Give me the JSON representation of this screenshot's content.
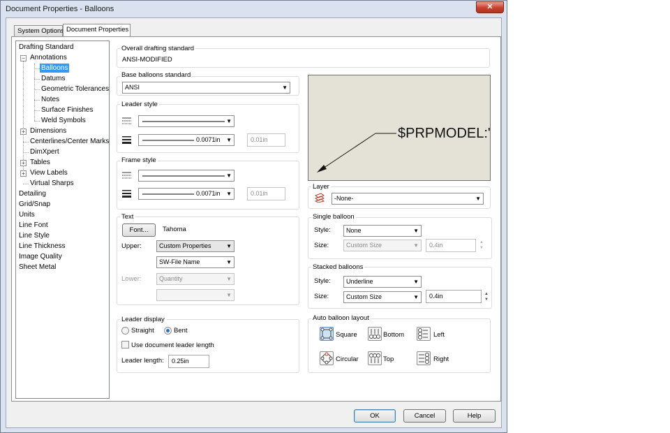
{
  "window": {
    "title": "Document Properties - Balloons",
    "close_glyph": "✕"
  },
  "tabs": [
    {
      "label": "System Options",
      "active": false
    },
    {
      "label": "Document Properties",
      "active": true
    }
  ],
  "tree": {
    "items": [
      {
        "label": "Drafting Standard"
      },
      {
        "label": "Annotations"
      },
      {
        "label": "Balloons"
      },
      {
        "label": "Datums"
      },
      {
        "label": "Geometric Tolerances"
      },
      {
        "label": "Notes"
      },
      {
        "label": "Surface Finishes"
      },
      {
        "label": "Weld Symbols"
      },
      {
        "label": "Dimensions"
      },
      {
        "label": "Centerlines/Center Marks"
      },
      {
        "label": "DimXpert"
      },
      {
        "label": "Tables"
      },
      {
        "label": "View Labels"
      },
      {
        "label": "Virtual Sharps"
      },
      {
        "label": "Detailing"
      },
      {
        "label": "Grid/Snap"
      },
      {
        "label": "Units"
      },
      {
        "label": "Line Font"
      },
      {
        "label": "Line Style"
      },
      {
        "label": "Line Thickness"
      },
      {
        "label": "Image Quality"
      },
      {
        "label": "Sheet Metal"
      }
    ],
    "selected": "Balloons"
  },
  "overall_standard": {
    "title": "Overall drafting standard",
    "value": "ANSI-MODIFIED"
  },
  "base_standard": {
    "title": "Base balloons standard",
    "value": "ANSI"
  },
  "leader_style": {
    "title": "Leader style",
    "thickness": "0.0071in",
    "custom_thickness": "0.01in"
  },
  "frame_style": {
    "title": "Frame style",
    "thickness": "0.0071in",
    "custom_thickness": "0.01in"
  },
  "text": {
    "title": "Text",
    "font_button": "Font...",
    "font_name": "Tahoma",
    "upper_label": "Upper:",
    "upper_value": "Custom Properties",
    "upper_value2": "SW-File Name",
    "lower_label": "Lower:",
    "lower_value": "Quantity",
    "lower_value2": ""
  },
  "leader_display": {
    "title": "Leader display",
    "straight": "Straight",
    "bent": "Bent",
    "use_doc_length": "Use document leader length",
    "length_label": "Leader length:",
    "length_value": "0.25in"
  },
  "preview": {
    "text": "$PRPMODEL:'"
  },
  "layer": {
    "title": "Layer",
    "value": "-None-"
  },
  "single_balloon": {
    "title": "Single balloon",
    "style_label": "Style:",
    "style_value": "None",
    "size_label": "Size:",
    "size_value": "Custom Size",
    "size_custom": "0.4in"
  },
  "stacked_balloons": {
    "title": "Stacked balloons",
    "style_label": "Style:",
    "style_value": "Underline",
    "size_label": "Size:",
    "size_value": "Custom Size",
    "size_custom": "0.4in"
  },
  "auto_layout": {
    "title": "Auto balloon layout",
    "square": "Square",
    "bottom": "Bottom",
    "left": "Left",
    "circular": "Circular",
    "top": "Top",
    "right": "Right"
  },
  "buttons": {
    "ok": "OK",
    "cancel": "Cancel",
    "help": "Help"
  },
  "colors": {
    "selection": "#3399ff",
    "preview_bg": "#e4e2d6",
    "close_red": "#c7402c"
  }
}
